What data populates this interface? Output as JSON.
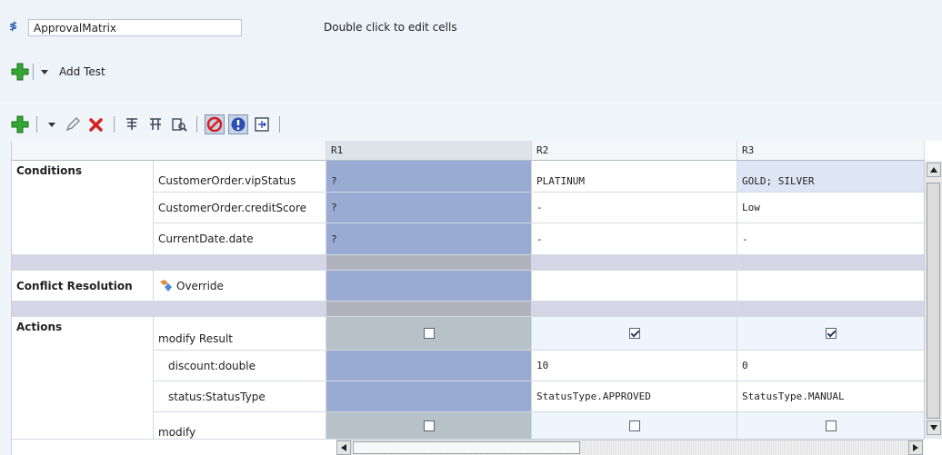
{
  "header": {
    "name_value": "ApprovalMatrix",
    "hint": "Double click to edit cells",
    "add_test_label": "Add Test"
  },
  "toolbar": {
    "icons": [
      "add-icon",
      "dropdown-caret-icon",
      "edit-pencil-icon",
      "delete-x-icon",
      "split-icon",
      "merge-icon",
      "validate-icon",
      "conflict-stop-icon",
      "info-icon",
      "compact-icon"
    ]
  },
  "grid": {
    "columns": [
      "R1",
      "R2",
      "R3"
    ],
    "sections": {
      "conditions": "Conditions",
      "conflict": "Conflict Resolution",
      "actions": "Actions"
    },
    "conditions": [
      {
        "label": "CustomerOrder.vipStatus",
        "values": [
          "?",
          "PLATINUM",
          "GOLD; SILVER"
        ]
      },
      {
        "label": "CustomerOrder.creditScore",
        "values": [
          "?",
          "-",
          "Low"
        ]
      },
      {
        "label": "CurrentDate.date",
        "values": [
          "?",
          "-",
          "-"
        ]
      }
    ],
    "conflict_label": "Override",
    "actions": [
      {
        "label": "modify Result",
        "checks": [
          false,
          true,
          true
        ]
      },
      {
        "label": "discount:double",
        "values": [
          "",
          "10",
          "0"
        ]
      },
      {
        "label": "status:StatusType",
        "values": [
          "",
          "StatusType.APPROVED",
          "StatusType.MANUAL"
        ]
      },
      {
        "label": "modify",
        "checks": [
          false,
          false,
          false
        ]
      }
    ]
  },
  "colors": {
    "selected_column": "#9aabd3",
    "separator_row": "#d5d5e6",
    "add_green": "#2e9a2e",
    "delete_red": "#d42020"
  }
}
